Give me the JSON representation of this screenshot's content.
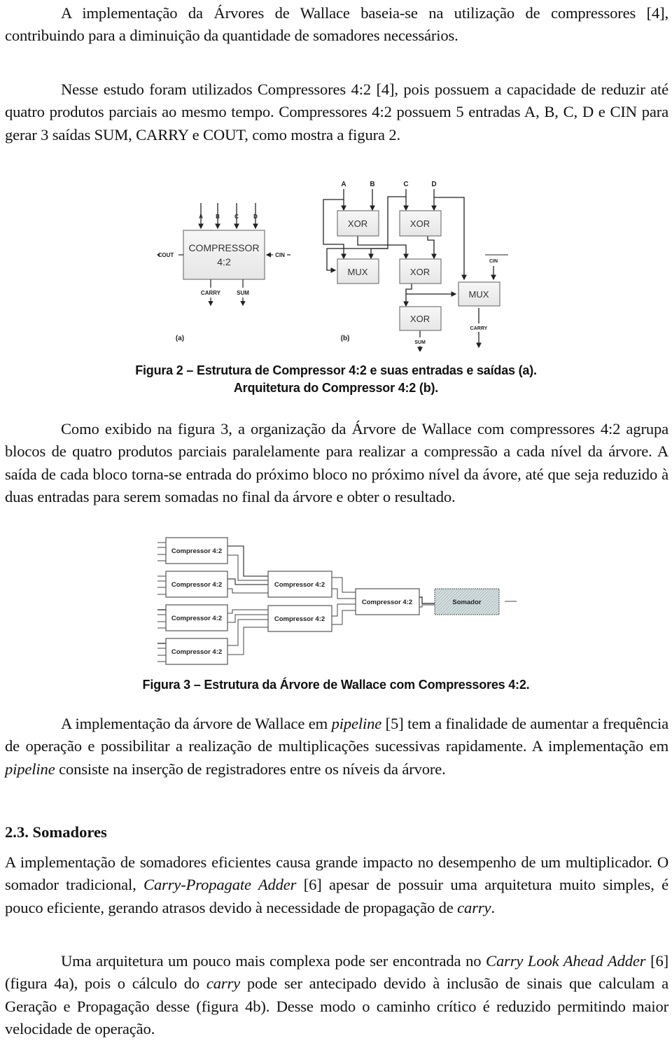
{
  "paragraphs": {
    "p1": "A implementação da Árvores de Wallace baseia-se na utilização de compressores [4], contribuindo para a diminuição da quantidade de somadores necessários.",
    "p2": "Nesse estudo foram utilizados Compressores 4:2 [4], pois possuem a capacidade de reduzir até quatro produtos parciais ao mesmo tempo. Compressores 4:2 possuem 5 entradas A, B, C, D e CIN para gerar 3 saídas SUM, CARRY e COUT, como mostra a figura 2.",
    "p3": "Como exibido na figura 3, a organização da Árvore de Wallace com compressores 4:2 agrupa blocos de quatro produtos parciais paralelamente para realizar a compressão a cada nível da árvore. A saída de cada bloco torna-se entrada do próximo bloco no próximo nível da ávore, até que seja reduzido à duas entradas para serem somadas no final da árvore e obter o resultado.",
    "p4": {
      "a": "A implementação da árvore de Wallace em ",
      "b": "pipeline",
      "c": " [5] tem a finalidade de aumentar a frequência de operação e possibilitar a realização de multiplicações sucessivas rapidamente. A implementação em ",
      "d": "pipeline",
      "e": " consiste na inserção de registradores entre os níveis da árvore."
    },
    "p5": {
      "a": "A implementação de somadores eficientes causa grande impacto no desempenho de um multiplicador. O somador tradicional, ",
      "b": "Carry-Propagate Adder",
      "c": " [6] apesar de possuir uma arquitetura muito simples, é pouco eficiente, gerando atrasos devido à necessidade de propagação de ",
      "d": "carry",
      "e": "."
    },
    "p6": {
      "a": "Uma arquitetura um pouco mais complexa pode ser encontrada no ",
      "b": "Carry Look Ahead Adder",
      "c": " [6] (figura 4a), pois o cálculo do ",
      "d": "carry",
      "e": " pode ser antecipado devido à inclusão de sinais que calculam a Geração e Propagação desse (figura 4b). Desse modo o caminho crítico é reduzido permitindo maior velocidade de operação."
    }
  },
  "section_heading": "2.3. Somadores",
  "figure2": {
    "caption_line1": "Figura 2 – Estrutura de Compressor 4:2 e suas entradas e saídas (a).",
    "caption_line2": "Arquitetura do Compressor 4:2 (b).",
    "panel_a": {
      "block_line1": "COMPRESSOR",
      "block_line2": "4:2",
      "inputs": [
        "A",
        "B",
        "C",
        "D"
      ],
      "cin": "CIN",
      "cout": "COUT",
      "outputs": [
        "CARRY",
        "SUM"
      ],
      "label": "(a)"
    },
    "panel_b": {
      "inputs": [
        "A",
        "B",
        "C",
        "D"
      ],
      "xor_label": "XOR",
      "mux_label": "MUX",
      "cin": "CIN",
      "carry": "CARRY",
      "sum": "SUM",
      "label": "(b)"
    }
  },
  "figure3": {
    "caption": "Figura 3 – Estrutura da Árvore de Wallace com Compressores 4:2.",
    "compressor_label": "Compressor 4:2",
    "adder_label": "Somador"
  }
}
